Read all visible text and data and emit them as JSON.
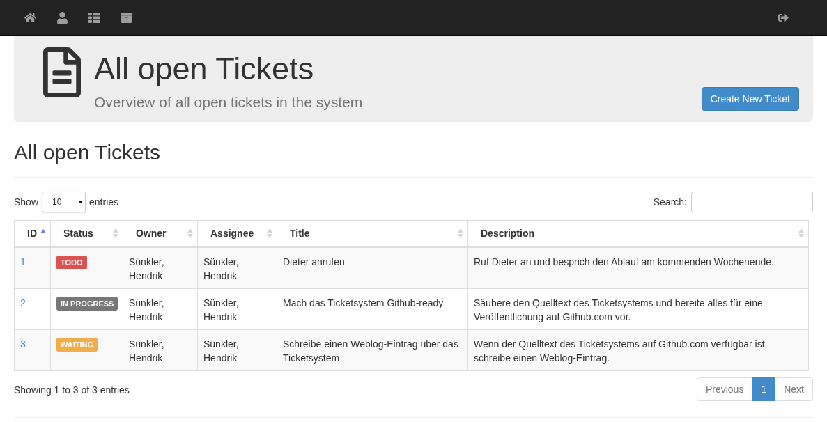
{
  "jumbotron": {
    "title": "All open Tickets",
    "subtitle": "Overview of all open tickets in the system",
    "button": "Create New Ticket"
  },
  "heading": "All open Tickets",
  "length": {
    "label_before": "Show",
    "value": "10",
    "label_after": "entries"
  },
  "search": {
    "label": "Search:"
  },
  "table": {
    "columns": [
      {
        "label": "ID",
        "sorted": true
      },
      {
        "label": "Status",
        "sorted": false
      },
      {
        "label": "Owner",
        "sorted": false
      },
      {
        "label": "Assignee",
        "sorted": false
      },
      {
        "label": "Title",
        "sorted": false
      },
      {
        "label": "Description",
        "sorted": false
      }
    ],
    "rows": [
      {
        "id": "1",
        "status": "TODO",
        "color": "#d9534f",
        "owner": "Sünkler, Hendrik",
        "assignee": "Sünkler, Hendrik",
        "title": "Dieter anrufen",
        "description": "Ruf Dieter an und besprich den Ablauf am kommenden Wochenende."
      },
      {
        "id": "2",
        "status": "IN PROGRESS",
        "color": "#777777",
        "owner": "Sünkler, Hendrik",
        "assignee": "Sünkler, Hendrik",
        "title": "Mach das Ticketsystem Github-ready",
        "description": "Säubere den Quelltext des Ticketsystems und bereite alles für eine Veröffentlichung auf Github.com vor."
      },
      {
        "id": "3",
        "status": "WAITING",
        "color": "#f0ad4e",
        "owner": "Sünkler, Hendrik",
        "assignee": "Sünkler, Hendrik",
        "title": "Schreibe einen Weblog-Eintrag über das Ticketsystem",
        "description": "Wenn der Quelltext des Ticketsystems auf Github.com verfügbar ist, schreibe einen Weblog-Eintrag."
      }
    ]
  },
  "info": "Showing 1 to 3 of 3 entries",
  "pagination": [
    {
      "label": "Previous",
      "disabled": true,
      "selected": false
    },
    {
      "label": "1",
      "disabled": false,
      "selected": true
    },
    {
      "label": "Next",
      "disabled": true,
      "selected": false
    }
  ]
}
